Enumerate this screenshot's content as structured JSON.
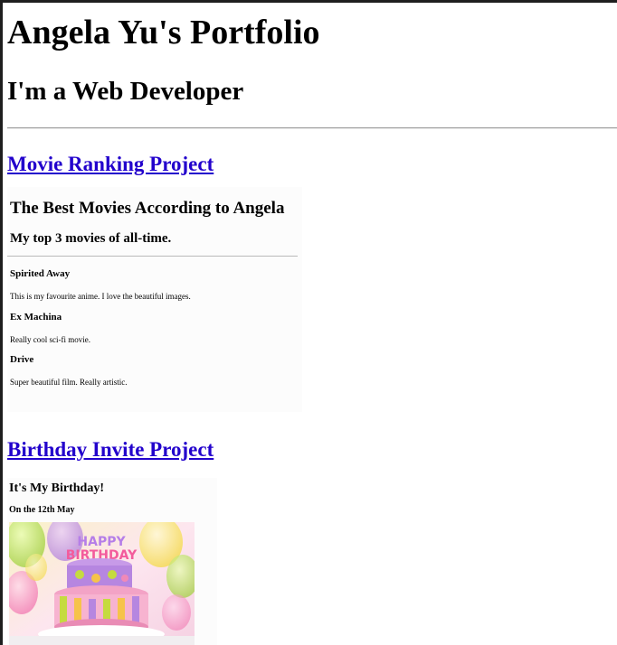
{
  "header": {
    "title": "Angela Yu's Portfolio",
    "subtitle": "I'm a Web Developer"
  },
  "projects": [
    {
      "link_label": "Movie Ranking Project",
      "preview": {
        "heading": "The Best Movies According to Angela",
        "subheading": "My top 3 movies of all-time.",
        "movies": [
          {
            "name": "Spirited Away",
            "description": "This is my favourite anime. I love the beautiful images."
          },
          {
            "name": "Ex Machina",
            "description": "Really cool sci-fi movie."
          },
          {
            "name": "Drive",
            "description": "Super beautiful film. Really artistic."
          }
        ]
      }
    },
    {
      "link_label": "Birthday Invite Project",
      "preview": {
        "heading": "It's My Birthday!",
        "date_line": "On the 12th May",
        "image": "birthday-cake-image",
        "image_text": "HAPPY BIRTHDAY"
      }
    }
  ]
}
